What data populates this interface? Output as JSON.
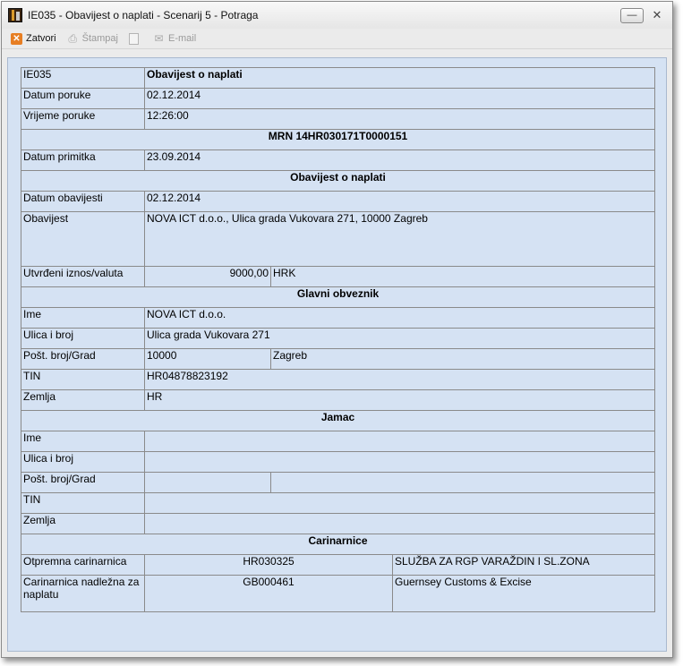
{
  "window": {
    "title": "IE035 - Obavijest o naplati - Scenarij 5 - Potraga"
  },
  "toolbar": {
    "zatvori": "Zatvori",
    "stampaj": "Štampaj",
    "email": "E-mail"
  },
  "doc": {
    "code": "IE035",
    "title": "Obavijest o naplati",
    "datum_poruke_label": "Datum poruke",
    "datum_poruke": "02.12.2014",
    "vrijeme_poruke_label": "Vrijeme poruke",
    "vrijeme_poruke": "12:26:00",
    "mrn": "MRN 14HR030171T0000151",
    "datum_primitka_label": "Datum primitka",
    "datum_primitka": "23.09.2014",
    "section_obavijest": "Obavijest o naplati",
    "datum_obavijesti_label": "Datum obavijesti",
    "datum_obavijesti": "02.12.2014",
    "obavijest_label": "Obavijest",
    "obavijest": "NOVA ICT d.o.o., Ulica grada Vukovara 271, 10000 Zagreb",
    "iznos_label": "Utvrđeni iznos/valuta",
    "iznos": "9000,00",
    "valuta": "HRK",
    "section_obveznik": "Glavni obveznik",
    "obveznik": {
      "ime_label": "Ime",
      "ime": "NOVA ICT d.o.o.",
      "ulica_label": "Ulica i broj",
      "ulica": "Ulica grada Vukovara 271",
      "post_label": "Pošt. broj/Grad",
      "post_broj": "10000",
      "grad": "Zagreb",
      "tin_label": "TIN",
      "tin": "HR04878823192",
      "zemlja_label": "Zemlja",
      "zemlja": "HR"
    },
    "section_jamac": "Jamac",
    "jamac": {
      "ime_label": "Ime",
      "ulica_label": "Ulica i broj",
      "post_label": "Pošt. broj/Grad",
      "tin_label": "TIN",
      "zemlja_label": "Zemlja"
    },
    "section_carinarnice": "Carinarnice",
    "otpremna_label": "Otpremna carinarnica",
    "otpremna_code": "HR030325",
    "otpremna_name": "SLUŽBA ZA RGP VARAŽDIN I SL.ZONA",
    "nadlezna_label": "Carinarnica nadležna za naplatu",
    "nadlezna_code": "GB000461",
    "nadlezna_name": "Guernsey Customs & Excise"
  }
}
